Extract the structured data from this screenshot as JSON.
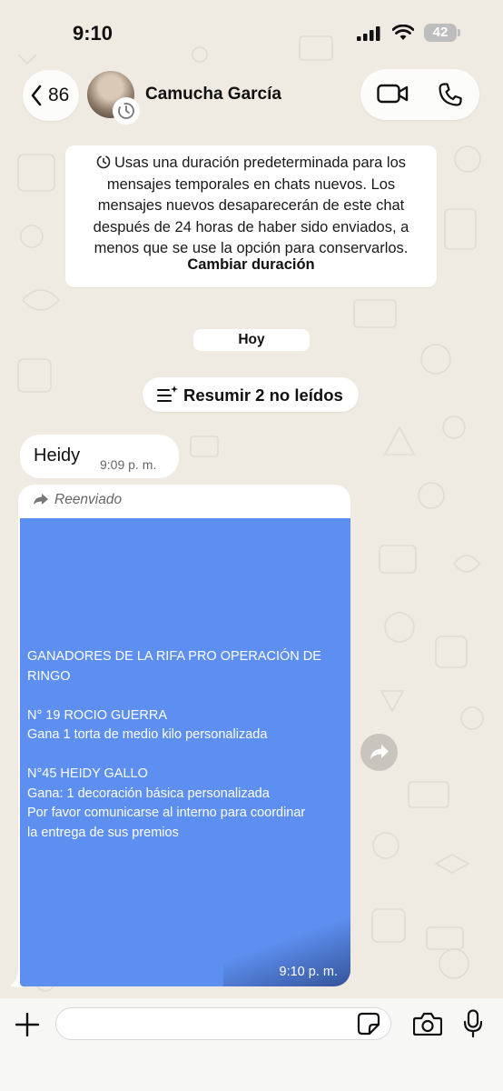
{
  "status_bar": {
    "time": "9:10",
    "battery": "42"
  },
  "header": {
    "back_count": "86",
    "contact_name": "Camucha García"
  },
  "system_notice": {
    "text": "Usas una duración predeterminada para los mensajes temporales en chats nuevos. Los mensajes nuevos desaparecerán de este chat después de 24 horas de haber sido enviados, a menos que se use la opción para conservarlos.",
    "link": "Cambiar duración"
  },
  "date_chip": "Hoy",
  "summary_button": "Resumir 2 no leídos",
  "messages": [
    {
      "text": "Heidy",
      "time": "9:09 p. m."
    },
    {
      "forwarded_label": "Reenviado",
      "image_lines": [
        "GANADORES DE LA RIFA PRO OPERACIÓN DE",
        "RINGO",
        "",
        "N° 19 ROCIO GUERRA",
        "Gana 1 torta de medio kilo personalizada",
        "",
        "N°45 HEIDY GALLO",
        "Gana: 1 decoración básica personalizada",
        "Por favor comunicarse al interno para coordinar",
        "la entrega de sus premios"
      ],
      "time": "9:10 p. m."
    }
  ],
  "composer": {
    "placeholder": ""
  },
  "icons": {
    "back": "chevron-left-icon",
    "video": "video-camera-icon",
    "phone": "phone-icon",
    "timer": "timer-icon",
    "summary": "summary-sparkle-icon",
    "forward": "forward-arrow-icon",
    "share": "share-forward-icon",
    "plus": "plus-icon",
    "sticker": "sticker-icon",
    "camera": "camera-icon",
    "mic": "microphone-icon"
  },
  "colors": {
    "wallpaper": "#efeae2",
    "bubble": "#ffffff",
    "image_bg": "#5d8ff0",
    "composer": "#f7f7f6"
  }
}
